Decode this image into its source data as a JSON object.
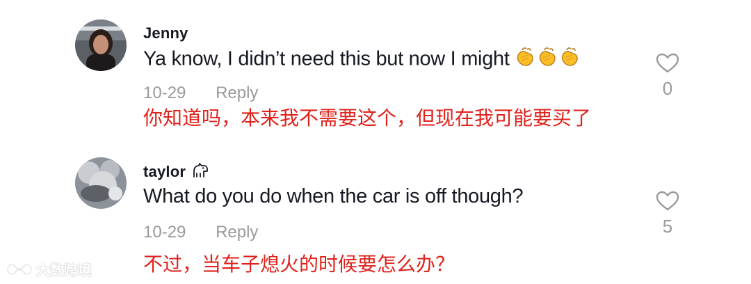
{
  "comments": [
    {
      "username": "Jenny",
      "text": "Ya know, I didn’t need this but now I might",
      "emojis": [
        "clapping-hands-emoji",
        "clapping-hands-emoji",
        "clapping-hands-emoji"
      ],
      "date": "10-29",
      "reply_label": "Reply",
      "translation": "你知道吗，本来我不需要这个，但现在我可能要买了",
      "like_count": "0"
    },
    {
      "username": "taylor",
      "badge_icon": "dog-icon",
      "text": "What do you do when the car is off though?",
      "date": "10-29",
      "reply_label": "Reply",
      "translation": "不过，当车子熄火的时候要怎么办？",
      "like_count": "5"
    }
  ],
  "watermark": {
    "text": "大数跨境"
  },
  "colors": {
    "text": "#161823",
    "meta": "#9a9a9a",
    "translation": "#e0221c"
  }
}
